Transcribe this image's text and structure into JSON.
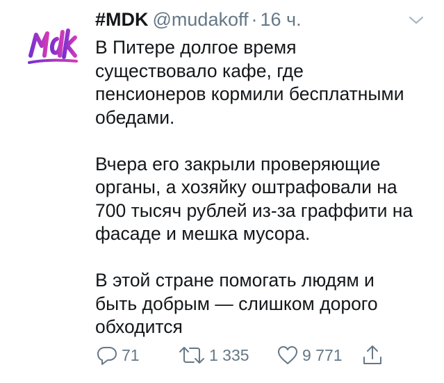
{
  "tweet": {
    "author_name": "#MDK",
    "author_handle": "@mudakoff",
    "separator": "·",
    "time": "16 ч.",
    "avatar_icon": "mdk-logo",
    "paragraphs": [
      "В Питере долгое время\nсуществовало кафе, где\nпенсионеров кормили бесплатными\nобедами.",
      "Вчера его закрыли проверяющие\nорганы, а хозяйку оштрафовали на\n700 тысяч рублей из-за граффити на\nфасаде и мешка мусора.",
      "В этой стране помогать людям и\nбыть добрым — слишком дорого\nобходится"
    ]
  },
  "actions": {
    "reply_count": "71",
    "retweet_count": "1 335",
    "like_count": "9 771",
    "reply_icon": "reply-icon",
    "retweet_icon": "retweet-icon",
    "like_icon": "heart-icon",
    "share_icon": "share-icon"
  },
  "colors": {
    "text": "#14171a",
    "secondary": "#657786",
    "logo_gradient": [
      "#7b2fd0",
      "#d13bb7"
    ]
  }
}
